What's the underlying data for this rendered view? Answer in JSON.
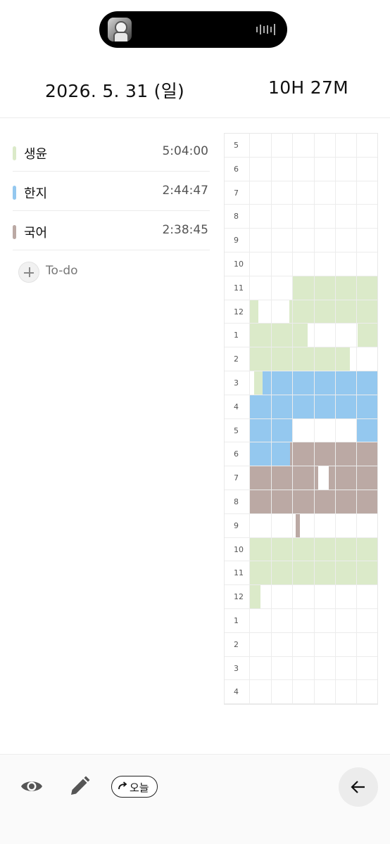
{
  "header": {
    "date": "2026. 5. 31 (일)",
    "total_time": "10H 27M"
  },
  "subjects": [
    {
      "name": "생윤",
      "time": "5:04:00",
      "color": "#dbeac9"
    },
    {
      "name": "한지",
      "time": "2:44:47",
      "color": "#94c8ef"
    },
    {
      "name": "국어",
      "time": "2:38:45",
      "color": "#bba9a4"
    }
  ],
  "todo": {
    "label": "To-do",
    "icon": "plus-icon"
  },
  "grid": {
    "hours": [
      "5",
      "6",
      "7",
      "8",
      "9",
      "10",
      "11",
      "12",
      "1",
      "2",
      "3",
      "4",
      "5",
      "6",
      "7",
      "8",
      "9",
      "10",
      "11",
      "12",
      "1",
      "2",
      "3",
      "4"
    ],
    "blocks": [
      {
        "subject": "생윤",
        "row": 6,
        "start": 2,
        "end": 6
      },
      {
        "subject": "생윤",
        "row": 7,
        "start": 0,
        "end": 0.4
      },
      {
        "subject": "생윤",
        "row": 7,
        "start": 1.85,
        "end": 6
      },
      {
        "subject": "생윤",
        "row": 8,
        "start": 0,
        "end": 2.7
      },
      {
        "subject": "생윤",
        "row": 8,
        "start": 5.05,
        "end": 6
      },
      {
        "subject": "생윤",
        "row": 9,
        "start": 0,
        "end": 4.7
      },
      {
        "subject": "생윤",
        "row": 10,
        "start": 0.2,
        "end": 0.6
      },
      {
        "subject": "한지",
        "row": 10,
        "start": 0.6,
        "end": 6
      },
      {
        "subject": "한지",
        "row": 11,
        "start": 0,
        "end": 6
      },
      {
        "subject": "한지",
        "row": 12,
        "start": 0,
        "end": 2
      },
      {
        "subject": "한지",
        "row": 12,
        "start": 5,
        "end": 6
      },
      {
        "subject": "한지",
        "row": 13,
        "start": 0,
        "end": 1.9
      },
      {
        "subject": "국어",
        "row": 13,
        "start": 1.9,
        "end": 6
      },
      {
        "subject": "국어",
        "row": 14,
        "start": 0,
        "end": 3.2
      },
      {
        "subject": "국어",
        "row": 14,
        "start": 3.7,
        "end": 6
      },
      {
        "subject": "국어",
        "row": 15,
        "start": 0,
        "end": 6
      },
      {
        "subject": "국어",
        "row": 16,
        "start": 2.15,
        "end": 2.35
      },
      {
        "subject": "생윤",
        "row": 17,
        "start": 0,
        "end": 6
      },
      {
        "subject": "생윤",
        "row": 18,
        "start": 0,
        "end": 6
      },
      {
        "subject": "생윤",
        "row": 19,
        "start": 0,
        "end": 0.5
      }
    ]
  },
  "toolbar": {
    "view_icon": "eye-icon",
    "edit_icon": "pencil-icon",
    "today_label": "오늘",
    "back_icon": "arrow-left-icon"
  }
}
